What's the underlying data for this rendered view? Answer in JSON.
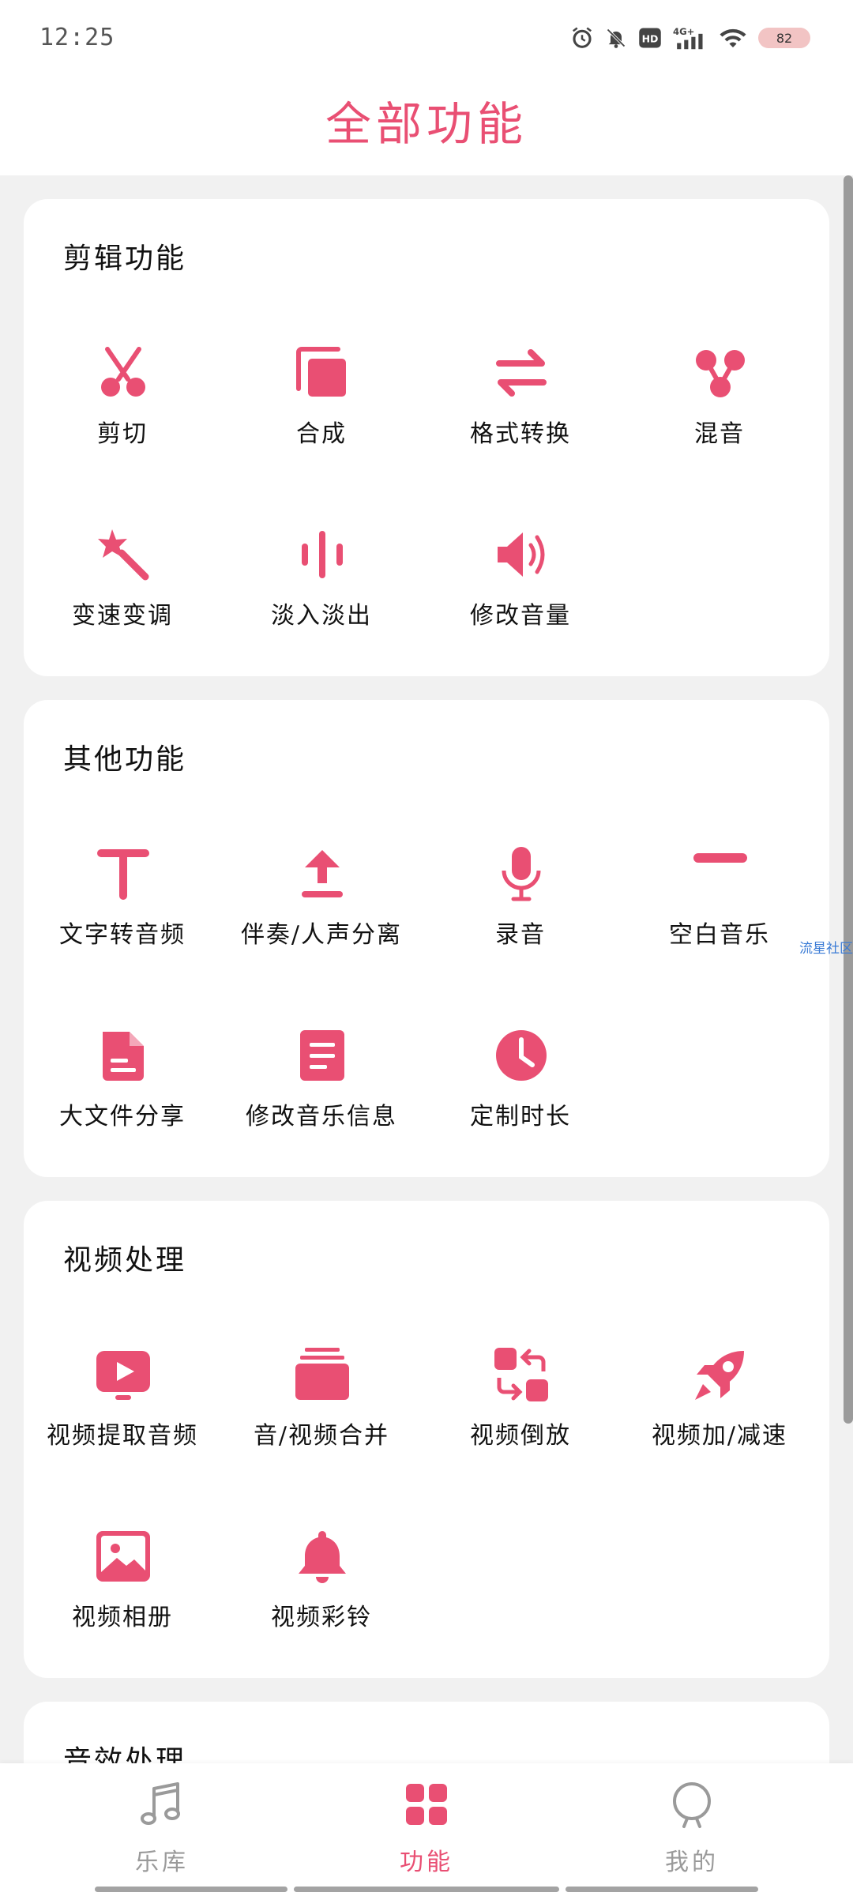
{
  "status": {
    "time": "12:25",
    "battery": "82"
  },
  "header": {
    "title": "全部功能"
  },
  "sections": {
    "edit": {
      "title": "剪辑功能",
      "items": [
        "剪切",
        "合成",
        "格式转换",
        "混音",
        "变速变调",
        "淡入淡出",
        "修改音量"
      ]
    },
    "other": {
      "title": "其他功能",
      "items": [
        "文字转音频",
        "伴奏/人声分离",
        "录音",
        "空白音乐",
        "大文件分享",
        "修改音乐信息",
        "定制时长"
      ]
    },
    "video": {
      "title": "视频处理",
      "items": [
        "视频提取音频",
        "音/视频合并",
        "视频倒放",
        "视频加/减速",
        "视频相册",
        "视频彩铃"
      ]
    },
    "audio": {
      "title": "音效处理"
    }
  },
  "watermark": "流星社区",
  "nav": {
    "library": "乐库",
    "features": "功能",
    "mine": "我的"
  },
  "colors": {
    "accent": "#e94f73",
    "background": "#f1f1f1",
    "card": "#ffffff"
  }
}
